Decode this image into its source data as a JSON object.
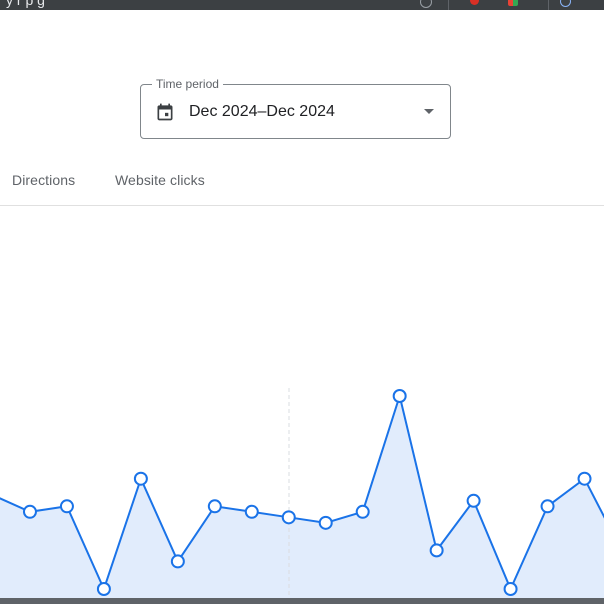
{
  "browser_bar": {
    "title_text": "y      r p    g",
    "bg_color": "#3c4043"
  },
  "time_period": {
    "label": "Time period",
    "value": "Dec 2024–Dec 2024",
    "icon": "calendar-icon"
  },
  "tabs": [
    {
      "label": "Directions"
    },
    {
      "label": "Website clicks"
    }
  ],
  "colors": {
    "line": "#1a73e8",
    "area": "#e1ecfc",
    "marker_fill": "#ffffff",
    "divider": "#e0e0e0"
  },
  "chart_data": {
    "type": "area",
    "title": "",
    "xlabel": "",
    "ylabel": "",
    "grid": false,
    "y": [
      7,
      4,
      5,
      -10,
      10,
      -5,
      5,
      4,
      3,
      2,
      4,
      25,
      -3,
      6,
      -10,
      5,
      10,
      -3
    ],
    "y_range": [
      -10,
      25
    ]
  }
}
